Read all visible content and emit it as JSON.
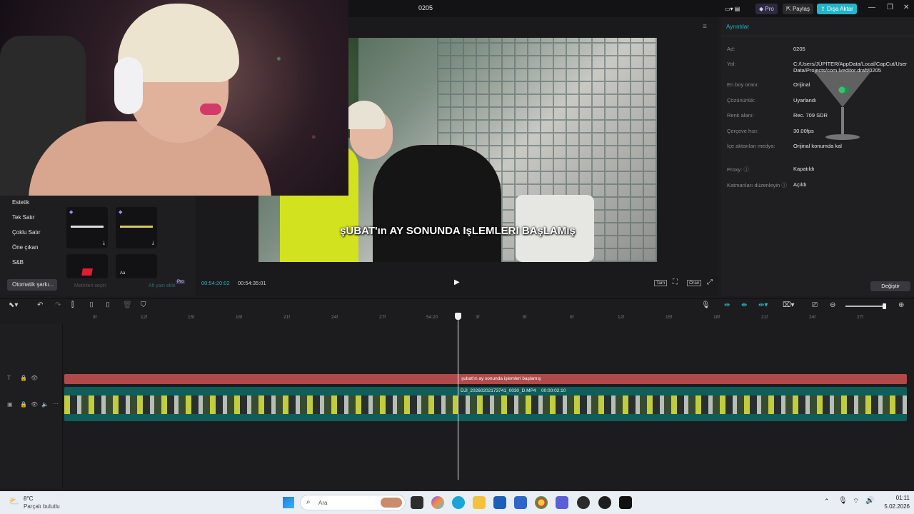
{
  "window": {
    "title": "0205",
    "pro_badge": "Pro",
    "share_label": "Paylaş",
    "export_label": "Dışa Aktar"
  },
  "colors": {
    "accent": "#21b6c9",
    "text_clip": "#b04a4a",
    "video_clip": "#0f5e5a",
    "background": "#1c1c1e"
  },
  "left_panel": {
    "categories": [
      "Estetik",
      "Tek Satır",
      "Çoklu Satır",
      "Öne çıkan",
      "S&B",
      "Otomatik şarkı..."
    ],
    "hint_left": "Metinleri seçin",
    "hint_right": "Alt yazı ekle",
    "hint_pro": "Pro"
  },
  "preview": {
    "subtitle": "şUBAT'ın AY SONUNDA IşLEMLERI BAşLAMış",
    "current_time": "00:54:20:02",
    "total_time": "00:54:35:01",
    "btn_full": "Tam",
    "btn_ratio": "Oran"
  },
  "details": {
    "header": "Ayrıntılar",
    "rows": [
      {
        "label": "Ad:",
        "value": "0205"
      },
      {
        "label": "Yol:",
        "value": "C:/Users/JÜPİTER/AppData/Local/CapCut/User Data/Projects/com.lveditor.draft/0205"
      },
      {
        "label": "En boy oranı:",
        "value": "Orijinal"
      },
      {
        "label": "Çözünürlük:",
        "value": "Uyarlandı"
      },
      {
        "label": "Renk alanı:",
        "value": "Rec. 709 SDR"
      },
      {
        "label": "Çerçeve hızı:",
        "value": "30.00fps"
      },
      {
        "label": "İçe aktarılan medya:",
        "value": "Orijinal konumda kal"
      },
      {
        "label": "Proxy:",
        "value": "Kapatıldı"
      },
      {
        "label": "Katmanları düzenleyin",
        "value": "Açıldı"
      }
    ],
    "change_button": "Değiştir"
  },
  "timeline": {
    "ruler_ticks": [
      "9f",
      "12f",
      "15f",
      "18f",
      "21f",
      "24f",
      "27f",
      "54:20",
      "3f",
      "6f",
      "9f",
      "12f",
      "15f",
      "18f",
      "21f",
      "24f",
      "27f"
    ],
    "text_clip_label": "şubat'ın ay sonunda işlemleri başlamış",
    "video_clip_name": "DJI_20260202173741_0030_D.MP4",
    "video_clip_duration": "00:00:02:10"
  },
  "taskbar": {
    "weather_temp": "8°C",
    "weather_desc": "Parçalı bulutlu",
    "search_placeholder": "Ara",
    "clock_time": "01:11",
    "clock_date": "5.02.2026"
  }
}
